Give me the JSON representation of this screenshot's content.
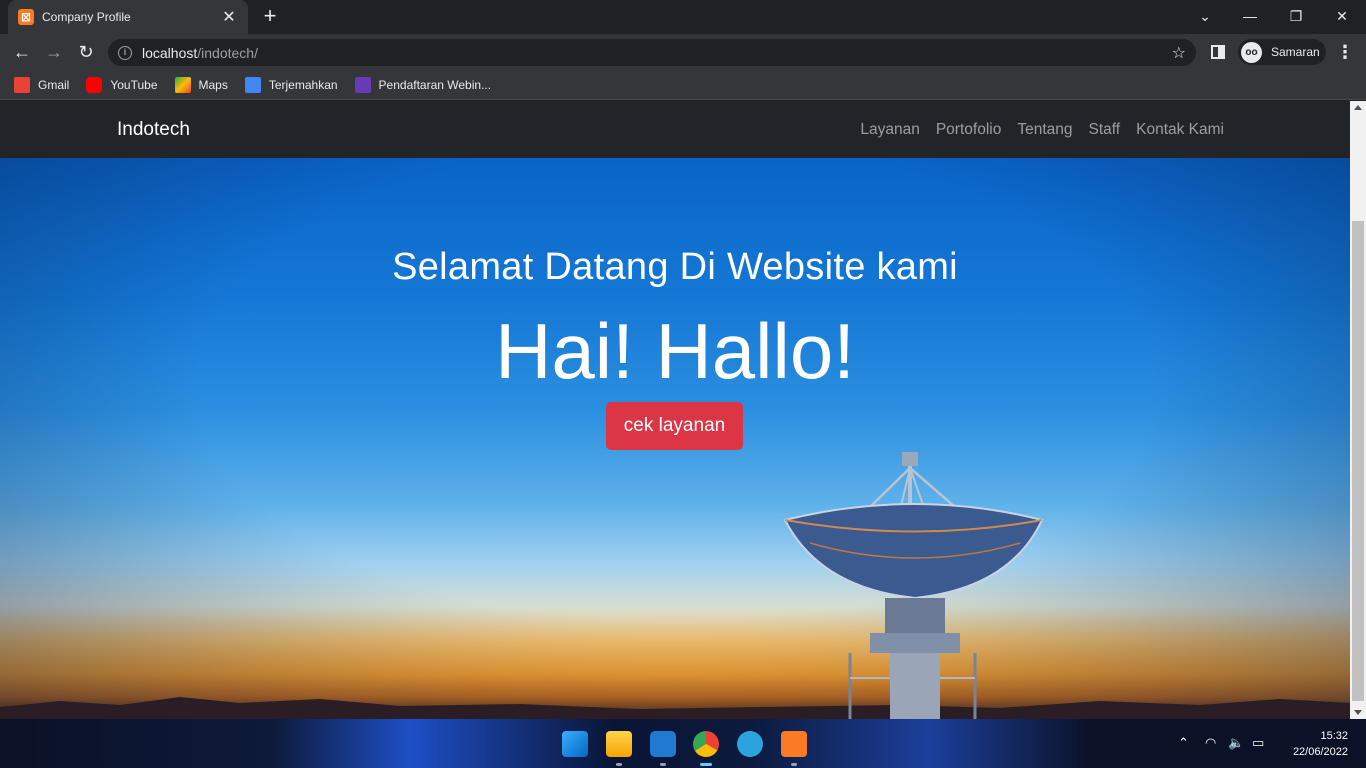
{
  "browser": {
    "tab_title": "Company Profile",
    "url_host": "localhost",
    "url_path": "/indotech/",
    "profile_name": "Samaran",
    "bookmarks": [
      {
        "label": "Gmail",
        "icon": "gmail-icon",
        "color": "#ea4335"
      },
      {
        "label": "YouTube",
        "icon": "youtube-icon",
        "color": "#ff0000"
      },
      {
        "label": "Maps",
        "icon": "maps-icon",
        "color": "#34a853"
      },
      {
        "label": "Terjemahkan",
        "icon": "translate-icon",
        "color": "#4285f4"
      },
      {
        "label": "Pendaftaran Webin...",
        "icon": "forms-icon",
        "color": "#673ab7"
      }
    ]
  },
  "site": {
    "brand": "Indotech",
    "nav": [
      "Layanan",
      "Portofolio",
      "Tentang",
      "Staff",
      "Kontak Kami"
    ],
    "hero": {
      "subtitle": "Selamat Datang Di Website kami",
      "title": "Hai! Hallo!",
      "button_label": "cek layanan",
      "button_color": "#dc3545"
    }
  },
  "taskbar": {
    "time": "15:32",
    "date": "22/06/2022",
    "apps": [
      "windows-start-icon",
      "file-explorer-icon",
      "vscode-icon",
      "chrome-icon",
      "telegram-icon",
      "xampp-icon"
    ]
  }
}
